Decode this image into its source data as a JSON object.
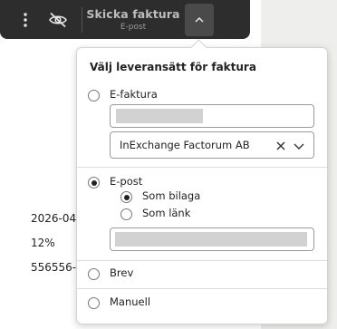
{
  "toolbar": {
    "send_title": "Skicka faktura",
    "send_subtitle": "E-post"
  },
  "background_rows": [
    "2026-04-",
    "12%",
    "556556-"
  ],
  "popover": {
    "title": "Välj leveransätt för faktura",
    "options": {
      "efaktura": {
        "label": "E-faktura",
        "selected": false,
        "provider": "InExchange Factorum AB"
      },
      "epost": {
        "label": "E-post",
        "selected": true,
        "sub_options": [
          {
            "label": "Som bilaga",
            "selected": true
          },
          {
            "label": "Som länk",
            "selected": false
          }
        ]
      },
      "brev": {
        "label": "Brev",
        "selected": false
      },
      "manuell": {
        "label": "Manuell",
        "selected": false
      }
    }
  },
  "colors": {
    "toolbar": "#2d2d2d",
    "caret_button": "#4a4a4a",
    "input_fill": "#d2d2d2"
  }
}
